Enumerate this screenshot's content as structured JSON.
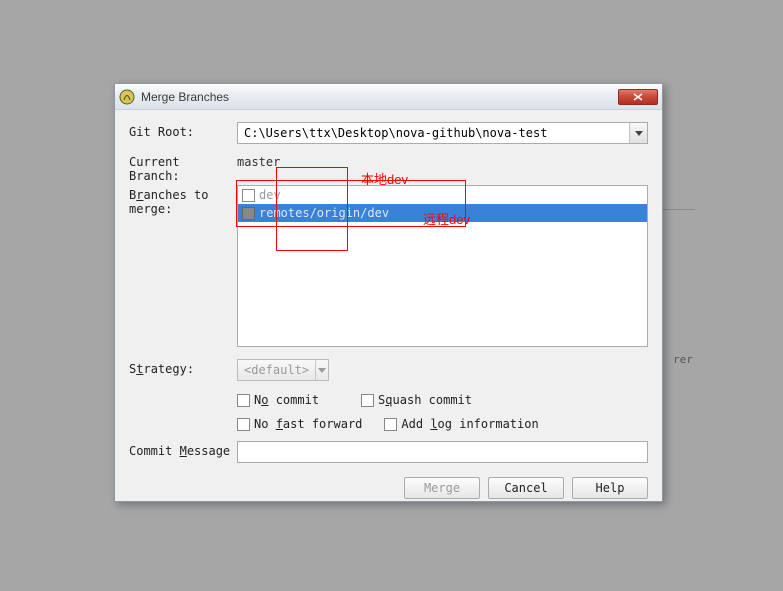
{
  "dialog": {
    "title": "Merge Branches",
    "labels": {
      "git_root": "Git Root:",
      "current_branch": "Current Branch:",
      "branches_to_merge_pre": "B",
      "branches_to_merge_u": "r",
      "branches_to_merge_post": "anches to merge:",
      "strategy_pre": "S",
      "strategy_u": "t",
      "strategy_post": "rategy:",
      "commit_message_pre": "Commit ",
      "commit_message_u": "M",
      "commit_message_post": "essage"
    },
    "git_root_value": "C:\\Users\\ttx\\Desktop\\nova-github\\nova-test",
    "current_branch_value": "master",
    "branches": [
      {
        "label": "dev",
        "selected": false,
        "checked": false
      },
      {
        "label": "remotes/origin/dev",
        "selected": true,
        "checked": false
      }
    ],
    "strategy_value": "<default>",
    "checkboxes": {
      "no_commit_pre": "N",
      "no_commit_u": "o",
      "no_commit_post": " commit",
      "squash_pre": "S",
      "squash_u": "q",
      "squash_post": "uash commit",
      "noff_pre": "No ",
      "noff_u": "f",
      "noff_post": "ast forward",
      "addlog_pre": "Add ",
      "addlog_u": "l",
      "addlog_post": "og information"
    },
    "commit_message_value": "",
    "buttons": {
      "merge": "Merge",
      "cancel": "Cancel",
      "help": "Help"
    }
  },
  "annotations": {
    "local": "本地dev",
    "remote": "远程dev"
  },
  "background": {
    "stray": "rer"
  }
}
